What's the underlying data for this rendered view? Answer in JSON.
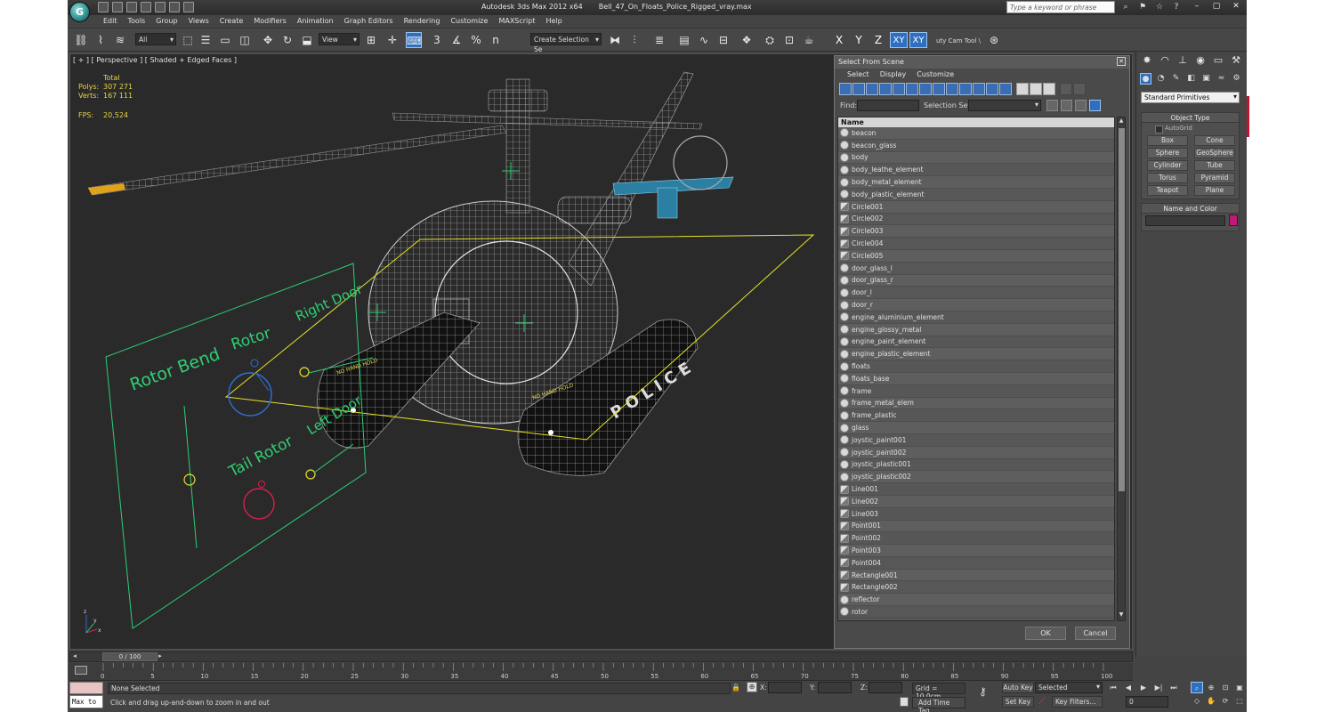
{
  "window": {
    "app_name": "Autodesk 3ds Max  2012 x64",
    "file_name": "Bell_47_On_Floats_Police_Rigged_vray.max",
    "search_placeholder": "Type a keyword or phrase",
    "logo": "G"
  },
  "menu": [
    "Edit",
    "Tools",
    "Group",
    "Views",
    "Create",
    "Modifiers",
    "Animation",
    "Graph Editors",
    "Rendering",
    "Customize",
    "MAXScript",
    "Help"
  ],
  "toolbar": {
    "filter_value": "All",
    "ref_coord_value": "View",
    "selection_set_value": "Create Selection Se",
    "axis_x": "X",
    "axis_y": "Y",
    "axis_z": "Z",
    "axis_xy": "XY",
    "axis_xy2": "XY",
    "cam_tool_label": "uty Cam Tool \\",
    "snap_labels": [
      "3",
      "%",
      "n"
    ]
  },
  "viewport": {
    "label": "[ + ] [ Perspective ] [ Shaded + Edged Faces ]",
    "stats": {
      "total_label": "Total",
      "polys_label": "Polys:",
      "polys_value": "307 271",
      "verts_label": "Verts:",
      "verts_value": "167 111",
      "fps_label": "FPS:",
      "fps_value": "20,524"
    },
    "rig_labels": {
      "rotor_bend": "Rotor Bend",
      "rotor": "Rotor",
      "right_door": "Right Door",
      "left_door": "Left Door",
      "tail_rotor": "Tail Rotor"
    },
    "decal_text": "NO HAND HOLD",
    "police_text": "POLICE",
    "axis_x": "x",
    "axis_y": "y",
    "axis_z": "z"
  },
  "scene_dialog": {
    "title": "Select From Scene",
    "menu": [
      "Select",
      "Display",
      "Customize"
    ],
    "find_label": "Find:",
    "selection_set_label": "Selection Set:",
    "column_name": "Name",
    "items": [
      {
        "name": "beacon",
        "kind": "geometry"
      },
      {
        "name": "beacon_glass",
        "kind": "geometry"
      },
      {
        "name": "body",
        "kind": "geometry"
      },
      {
        "name": "body_leathe_element",
        "kind": "geometry"
      },
      {
        "name": "body_metal_element",
        "kind": "geometry"
      },
      {
        "name": "body_plastic_element",
        "kind": "geometry"
      },
      {
        "name": "Circle001",
        "kind": "shape"
      },
      {
        "name": "Circle002",
        "kind": "shape"
      },
      {
        "name": "Circle003",
        "kind": "shape"
      },
      {
        "name": "Circle004",
        "kind": "shape"
      },
      {
        "name": "Circle005",
        "kind": "shape"
      },
      {
        "name": "door_glass_l",
        "kind": "geometry"
      },
      {
        "name": "door_glass_r",
        "kind": "geometry"
      },
      {
        "name": "door_l",
        "kind": "geometry"
      },
      {
        "name": "door_r",
        "kind": "geometry"
      },
      {
        "name": "engine_aluminium_element",
        "kind": "geometry"
      },
      {
        "name": "engine_glossy_metal",
        "kind": "geometry"
      },
      {
        "name": "engine_paint_element",
        "kind": "geometry"
      },
      {
        "name": "engine_plastic_element",
        "kind": "geometry"
      },
      {
        "name": "floats",
        "kind": "geometry"
      },
      {
        "name": "floats_base",
        "kind": "geometry"
      },
      {
        "name": "frame",
        "kind": "geometry"
      },
      {
        "name": "frame_metal_elem",
        "kind": "geometry"
      },
      {
        "name": "frame_plastic",
        "kind": "geometry"
      },
      {
        "name": "glass",
        "kind": "geometry"
      },
      {
        "name": "joystic_paint001",
        "kind": "geometry"
      },
      {
        "name": "joystic_paint002",
        "kind": "geometry"
      },
      {
        "name": "joystic_plastic001",
        "kind": "geometry"
      },
      {
        "name": "joystic_plastic002",
        "kind": "geometry"
      },
      {
        "name": "Line001",
        "kind": "shape"
      },
      {
        "name": "Line002",
        "kind": "shape"
      },
      {
        "name": "Line003",
        "kind": "shape"
      },
      {
        "name": "Point001",
        "kind": "shape"
      },
      {
        "name": "Point002",
        "kind": "shape"
      },
      {
        "name": "Point003",
        "kind": "shape"
      },
      {
        "name": "Point004",
        "kind": "shape"
      },
      {
        "name": "Rectangle001",
        "kind": "shape"
      },
      {
        "name": "Rectangle002",
        "kind": "shape"
      },
      {
        "name": "reflector",
        "kind": "geometry"
      },
      {
        "name": "rotor",
        "kind": "geometry"
      }
    ],
    "ok_label": "OK",
    "cancel_label": "Cancel"
  },
  "command_panel": {
    "category": "Standard Primitives",
    "object_type_title": "Object Type",
    "autogrid_label": "AutoGrid",
    "buttons": [
      "Box",
      "Cone",
      "Sphere",
      "GeoSphere",
      "Cylinder",
      "Tube",
      "Torus",
      "Pyramid",
      "Teapot",
      "Plane"
    ],
    "name_color_title": "Name and Color",
    "swatch_color": "#c0197a"
  },
  "timeline": {
    "slider_label": "0 / 100",
    "ticks": [
      "0",
      "5",
      "10",
      "15",
      "20",
      "25",
      "30",
      "35",
      "40",
      "45",
      "50",
      "55",
      "60",
      "65",
      "70",
      "75",
      "80",
      "85",
      "90",
      "95",
      "100"
    ]
  },
  "status": {
    "maxscript_label": "Max to",
    "selection": "None Selected",
    "prompt": "Click and drag up-and-down to zoom in and out",
    "x_label": "X:",
    "y_label": "Y:",
    "z_label": "Z:",
    "grid": "Grid = 10,0cm",
    "add_time_tag": "Add Time Tag",
    "auto_key": "Auto Key",
    "set_key": "Set Key",
    "selected_value": "Selected",
    "key_filters": "Key Filters...",
    "frame_value": "0"
  },
  "colors": {
    "accent_blue": "#2f6fbf",
    "stats_yellow": "#e8d34a",
    "rig_green": "#2ecf73",
    "rig_blue": "#2f6fd8",
    "rig_red": "#d8204a",
    "rig_yellow": "#e6e02a",
    "red_tab": "#c8102e"
  },
  "icons": {
    "title_quick_access": [
      "new-icon",
      "open-icon",
      "save-icon",
      "undo-icon",
      "redo-icon",
      "project-icon",
      "dropdown-icon"
    ],
    "title_right": [
      "search-icon",
      "bookmark-icon",
      "star-icon",
      "help-icon"
    ],
    "command_tabs": [
      "create-icon",
      "modify-icon",
      "hierarchy-icon",
      "motion-icon",
      "display-icon",
      "utilities-icon"
    ],
    "create_types": [
      "geometry-icon",
      "shapes-icon",
      "lights-icon",
      "cameras-icon",
      "helpers-icon",
      "spacewarps-icon",
      "systems-icon"
    ]
  }
}
